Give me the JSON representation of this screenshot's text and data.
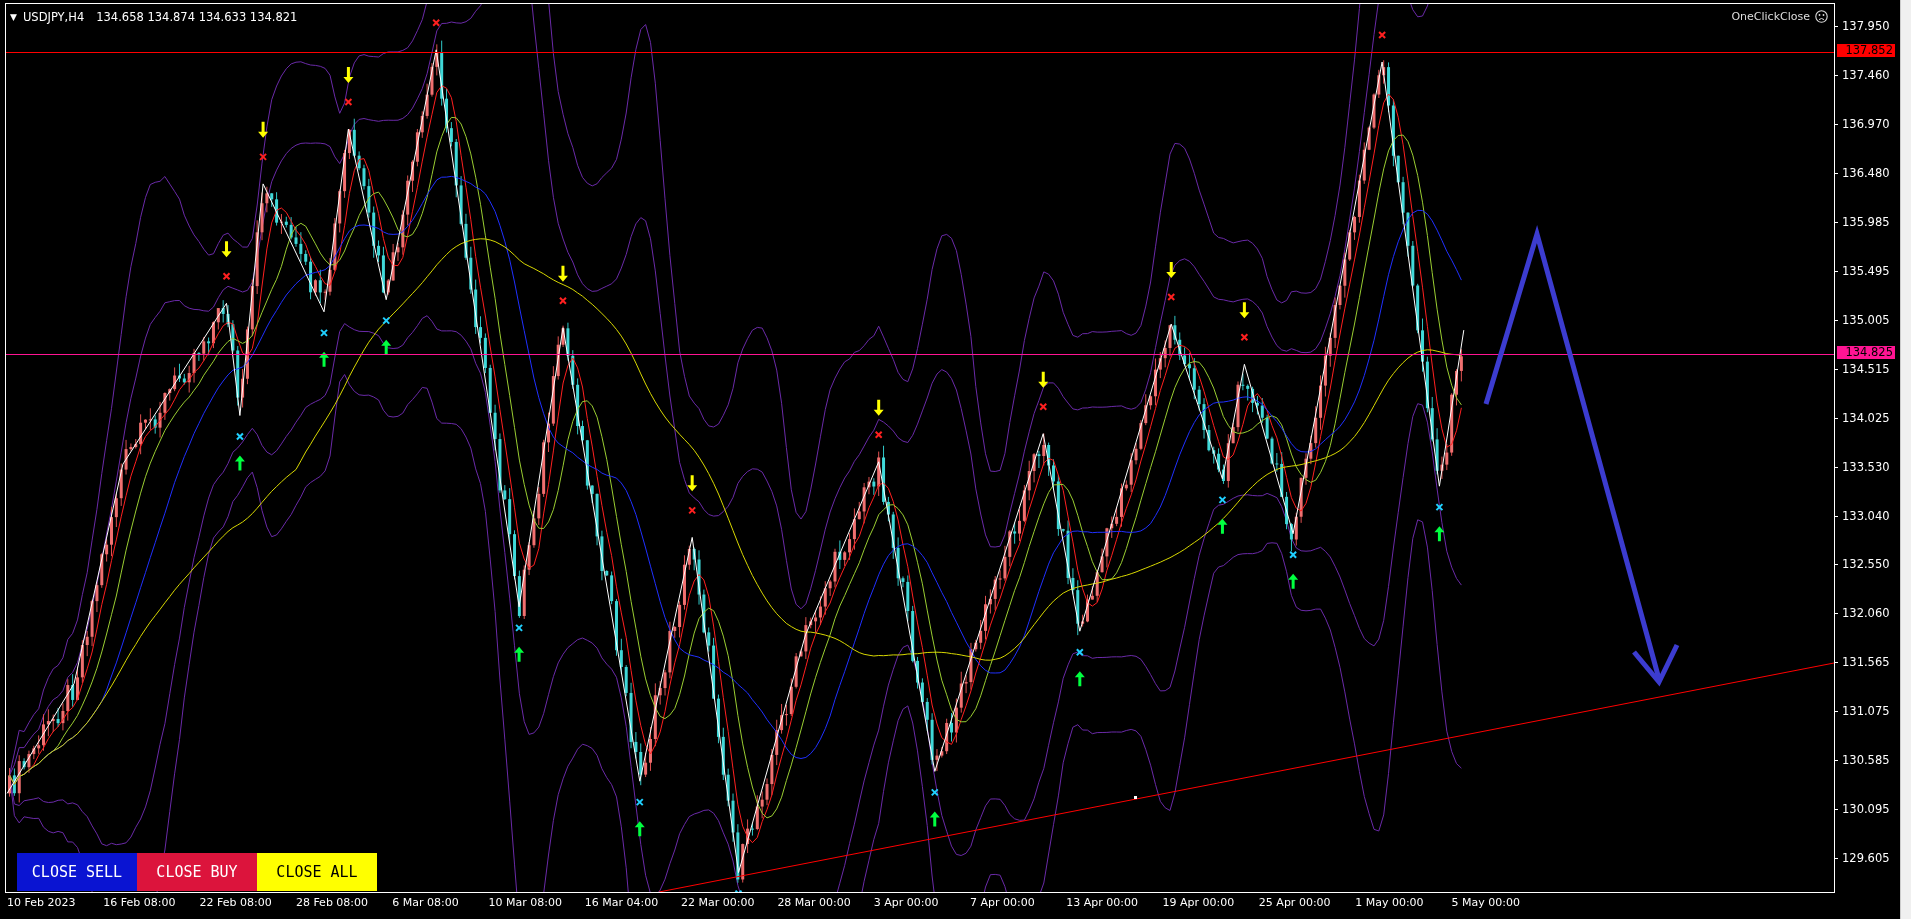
{
  "header": {
    "menu_glyph": "▼",
    "symbol": "USDJPY,H4",
    "ohlc": "134.658 134.874 134.633 134.821"
  },
  "expert": {
    "name": "OneClickClose"
  },
  "buttons": [
    {
      "label": "CLOSE SELL",
      "color": "#0a14d2"
    },
    {
      "label": "CLOSE BUY",
      "color": "#dc143c"
    },
    {
      "label": "CLOSE ALL",
      "color": "#ffff00"
    }
  ],
  "price_axis": [
    "137.950",
    "137.460",
    "136.970",
    "136.480",
    "135.985",
    "135.495",
    "135.005",
    "134.515",
    "134.025",
    "133.530",
    "133.040",
    "132.550",
    "132.060",
    "131.565",
    "131.075",
    "130.585",
    "130.095",
    "129.605"
  ],
  "price_lines": [
    {
      "label": "137.852",
      "color": "#ff0000"
    },
    {
      "label": "134.825",
      "color": "#ff1493"
    }
  ],
  "time_axis": [
    "10 Feb 2023",
    "16 Feb 08:00",
    "22 Feb 08:00",
    "28 Feb 08:00",
    "6 Mar 08:00",
    "10 Mar 08:00",
    "16 Mar 04:00",
    "22 Mar 00:00",
    "28 Mar 00:00",
    "3 Apr 00:00",
    "7 Apr 00:00",
    "13 Apr 00:00",
    "19 Apr 00:00",
    "25 Apr 00:00",
    "1 May 00:00",
    "5 May 00:00"
  ]
}
